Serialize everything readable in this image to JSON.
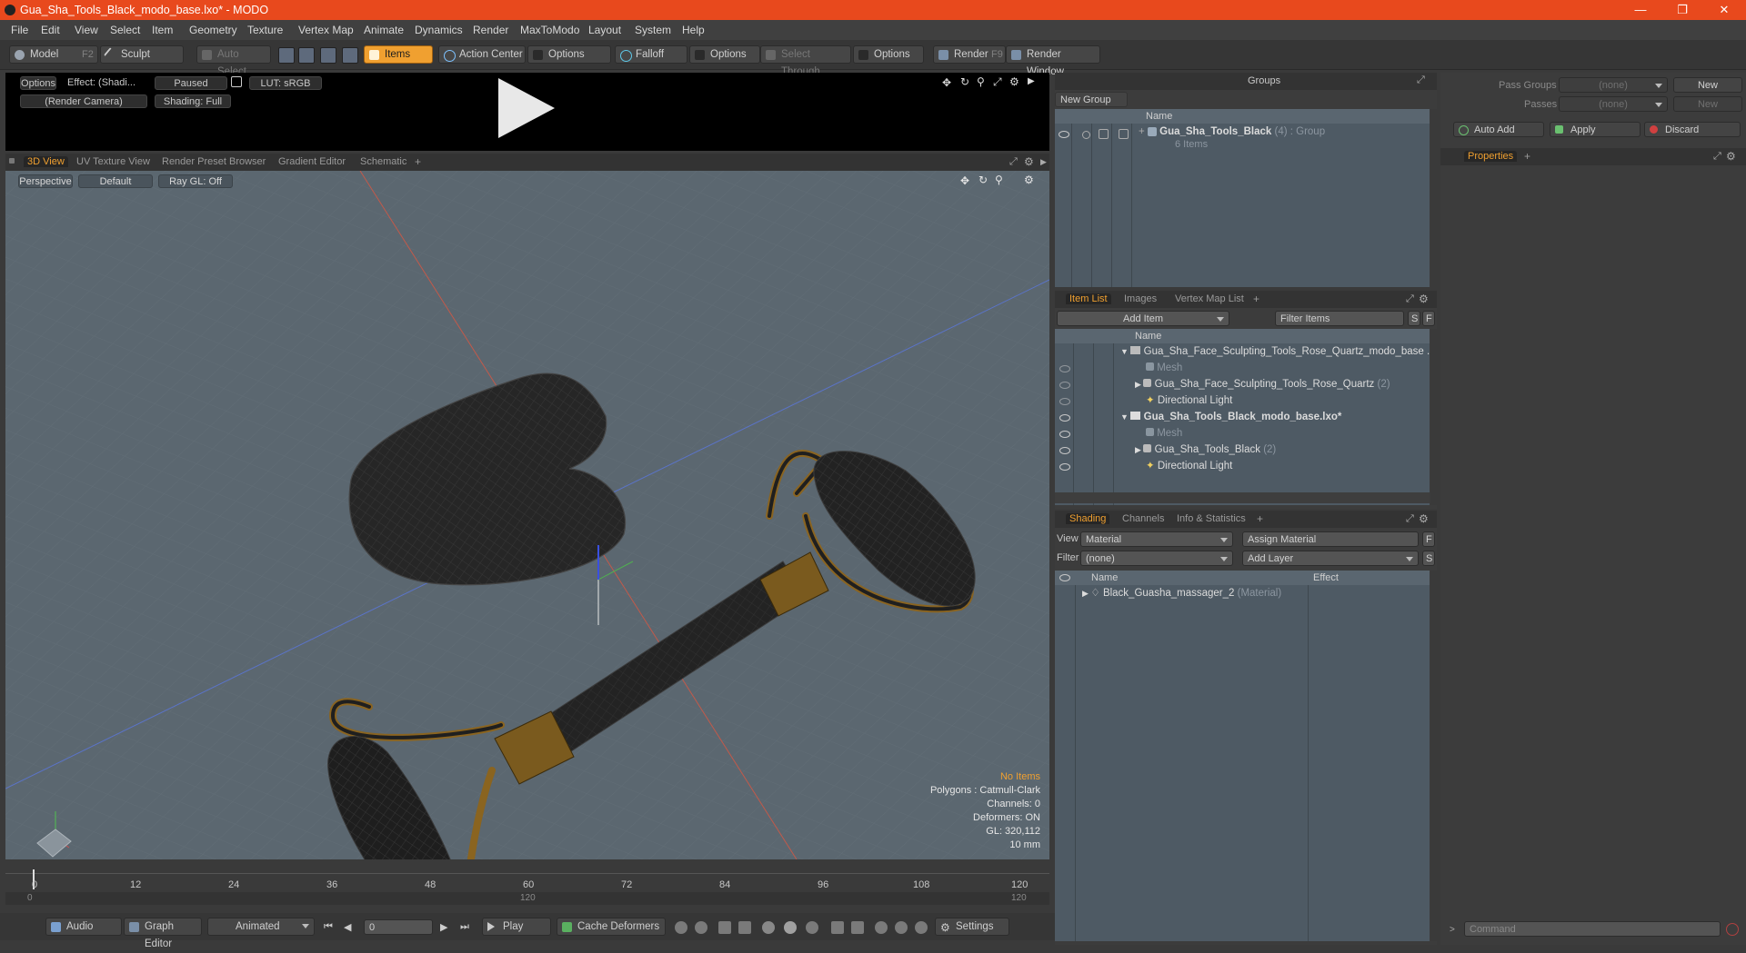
{
  "window": {
    "title": "Gua_Sha_Tools_Black_modo_base.lxo* - MODO"
  },
  "menu": [
    "File",
    "Edit",
    "View",
    "Select",
    "Item",
    "Geometry",
    "Texture",
    "Vertex Map",
    "Animate",
    "Dynamics",
    "Render",
    "MaxToModo",
    "Layout",
    "System",
    "Help"
  ],
  "toolbar": {
    "model": "Model",
    "model_key": "F2",
    "sculpt": "Sculpt",
    "auto_select": "Auto Select",
    "items": "Items",
    "action_center": "Action Center",
    "options1": "Options",
    "falloff": "Falloff",
    "options2": "Options",
    "select_through": "Select Through",
    "options3": "Options",
    "render": "Render",
    "render_key": "F9",
    "render_window": "Render Window"
  },
  "preview": {
    "options": "Options",
    "effect": "Effect: (Shadi...",
    "paused": "Paused",
    "lut": "LUT: sRGB",
    "camera": "(Render Camera)",
    "shading": "Shading: Full"
  },
  "view_tabs": [
    "3D View",
    "UV Texture View",
    "Render Preset Browser",
    "Gradient Editor",
    "Schematic"
  ],
  "viewport": {
    "perspective": "Perspective",
    "default": "Default",
    "raygl": "Ray GL: Off",
    "info_no_items": "No Items",
    "info_polygons": "Polygons : Catmull-Clark",
    "info_channels": "Channels: 0",
    "info_deformers": "Deformers: ON",
    "info_gl": "GL: 320,112",
    "info_unit": "10 mm"
  },
  "timeline": {
    "ticks": [
      "0",
      "12",
      "24",
      "36",
      "48",
      "60",
      "72",
      "84",
      "96",
      "108",
      "120"
    ],
    "lower_start": "0",
    "lower_mid": "120",
    "lower_end": "120"
  },
  "bottombar": {
    "audio": "Audio",
    "graph_editor": "Graph Editor",
    "animated": "Animated",
    "frame": "0",
    "play": "Play",
    "cache_deformers": "Cache Deformers",
    "settings": "Settings"
  },
  "groups": {
    "title": "Groups",
    "new_group": "New Group",
    "col_name": "Name",
    "item_name": "Gua_Sha_Tools_Black",
    "item_count": "(4)",
    "item_type": ": Group",
    "item_sub": "6 Items"
  },
  "itemlist": {
    "tabs": [
      "Item List",
      "Images",
      "Vertex Map List"
    ],
    "add_item": "Add Item",
    "filter_items": "Filter Items",
    "s_btn": "S",
    "f_btn": "F",
    "col_name": "Name",
    "rows": [
      {
        "label": "Gua_Sha_Face_Sculpting_Tools_Rose_Quartz_modo_base ...",
        "extra": ""
      },
      {
        "label": "Mesh",
        "extra": ""
      },
      {
        "label": "Gua_Sha_Face_Sculpting_Tools_Rose_Quartz",
        "extra": "(2)"
      },
      {
        "label": "Directional Light",
        "extra": ""
      },
      {
        "label": "Gua_Sha_Tools_Black_modo_base.lxo*",
        "extra": ""
      },
      {
        "label": "Mesh",
        "extra": ""
      },
      {
        "label": "Gua_Sha_Tools_Black",
        "extra": "(2)"
      },
      {
        "label": "Directional Light",
        "extra": ""
      }
    ]
  },
  "shading": {
    "tabs": [
      "Shading",
      "Channels",
      "Info & Statistics"
    ],
    "view_lbl": "View",
    "view_val": "Material",
    "assign_material": "Assign Material",
    "filter_lbl": "Filter",
    "filter_val": "(none)",
    "add_layer": "Add Layer",
    "f_btn": "F",
    "s_btn": "S",
    "col_name": "Name",
    "col_effect": "Effect",
    "row_name": "Black_Guasha_massager_2",
    "row_type": "(Material)"
  },
  "passes": {
    "pass_groups": "Pass Groups",
    "pass_groups_val": "(none)",
    "new1": "New",
    "passes": "Passes",
    "passes_val": "(none)",
    "new2": "New",
    "auto_add": "Auto Add",
    "apply": "Apply",
    "discard": "Discard"
  },
  "properties": {
    "tab": "Properties"
  },
  "command": {
    "placeholder": "Command"
  }
}
